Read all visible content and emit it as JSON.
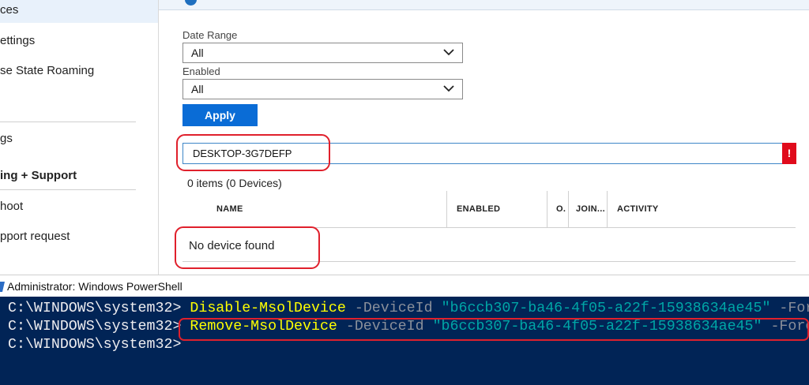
{
  "sidebar": {
    "items": [
      {
        "label": "ces",
        "selected": true
      },
      {
        "label": "ettings"
      },
      {
        "label": "se State Roaming"
      },
      {
        "label": "gs"
      },
      {
        "label": "ing + Support",
        "heading": true
      },
      {
        "label": "hoot"
      },
      {
        "label": "pport request"
      }
    ]
  },
  "filters": {
    "date_range_label": "Date Range",
    "date_range_value": "All",
    "enabled_label": "Enabled",
    "enabled_value": "All",
    "apply_label": "Apply"
  },
  "search": {
    "value": "DESKTOP-3G7DEFP",
    "error_glyph": "!"
  },
  "results": {
    "count_text": "0 items (0 Devices)",
    "columns": [
      "NAME",
      "ENABLED",
      "O.",
      "JOIN...",
      "ACTIVITY"
    ],
    "empty_text": "No device found"
  },
  "powershell": {
    "window_title": "Administrator: Windows PowerShell",
    "lines": [
      {
        "prompt": "C:\\WINDOWS\\system32> ",
        "cmdlet": "Disable-MsolDevice",
        "param": " -DeviceId ",
        "arg": "\"b6ccb307-ba46-4f05-a22f-15938634ae45\"",
        "flag": " -Force"
      },
      {
        "prompt": "C:\\WINDOWS\\system32> ",
        "cmdlet": "Remove-MsolDevice",
        "param": " -DeviceId ",
        "arg": "\"b6ccb307-ba46-4f05-a22f-15938634ae45\"",
        "flag": " -Force"
      },
      {
        "prompt": "C:\\WINDOWS\\system32>"
      }
    ]
  },
  "colors": {
    "accent": "#0a6cd6",
    "highlight_red": "#e0202c",
    "console_bg": "#012456",
    "console_cmd": "#ffff00",
    "console_string": "#00a6a6"
  }
}
